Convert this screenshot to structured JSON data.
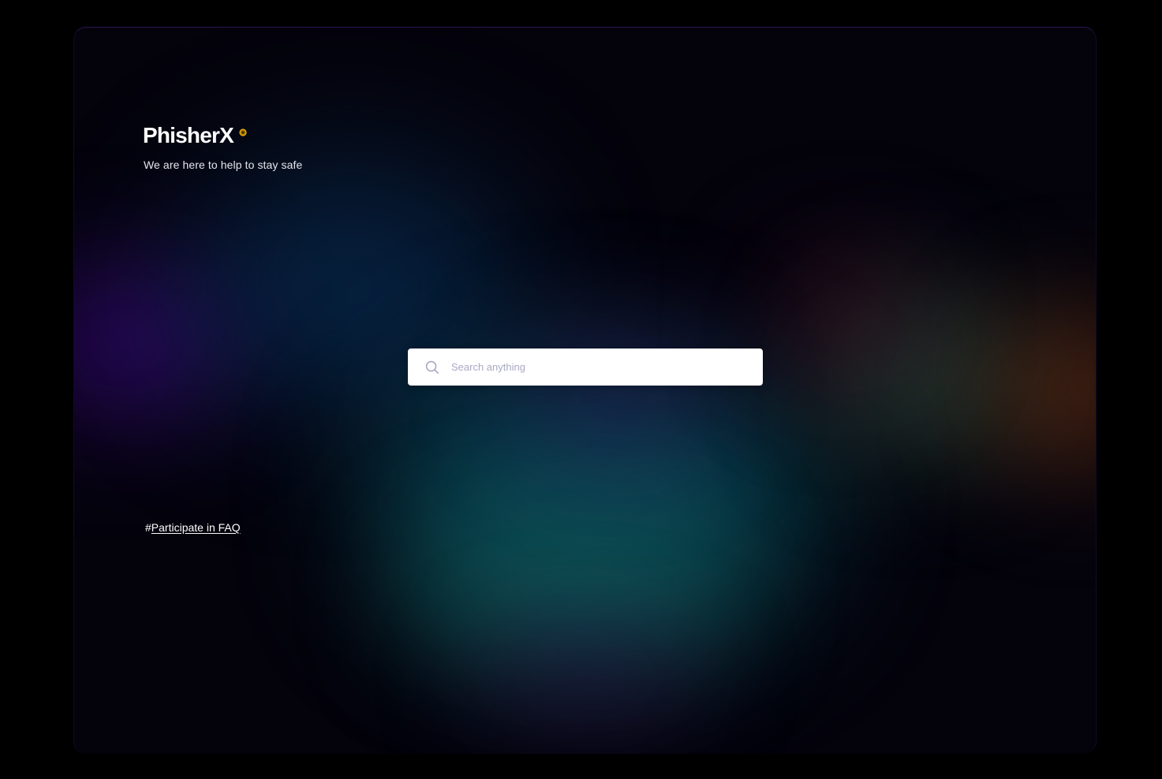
{
  "brand": {
    "name": "PhisherX",
    "tagline": "We are here to help to stay safe",
    "mark_icon": "sparkle-badge-icon",
    "mark_color": "#f5b400"
  },
  "search": {
    "placeholder": "Search anything",
    "value": "",
    "icon": "search-icon"
  },
  "faq": {
    "prefix": "#",
    "link_text": "Participate in FAQ"
  },
  "colors": {
    "page_background": "#000000",
    "panel_background": "#04030c",
    "text": "#ffffff",
    "placeholder": "#a9a9c4"
  }
}
